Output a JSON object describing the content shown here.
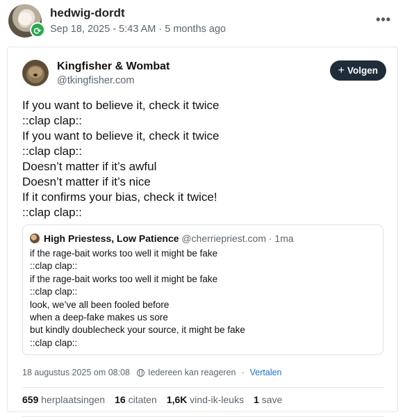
{
  "repost": {
    "user": "hedwig-dordt",
    "meta": "Sep 18, 2025 - 5:43 AM · 5 months ago",
    "more_label": "•••"
  },
  "post": {
    "author_name": "Kingfisher & Wombat",
    "author_handle": "@tkingfisher.com",
    "follow_label": "Volgen",
    "follow_icon": "plus-icon",
    "lines": [
      "If you want to believe it, check it twice",
      "::clap clap::",
      "If you want to believe it, check it twice",
      "::clap clap::",
      "Doesn’t matter if it’s awful",
      "Doesn’t matter if it’s nice",
      "If it confirms your bias, check it twice!",
      "::clap clap::"
    ],
    "quote": {
      "name": "High Priestess, Low Patience",
      "handle": "@cherriepriest.com",
      "time": "· 1ma",
      "lines": [
        "if the rage-bait works too well it might be fake",
        "::clap clap::",
        "if the rage-bait works too well it might be fake",
        "::clap clap::",
        "look, we’ve all been fooled before",
        "when a deep-fake makes us sore",
        "but kindly doublecheck your source, it might be fake",
        "::clap clap::"
      ]
    },
    "date": "18 augustus 2025 om 08:08",
    "reply_setting": "Iedereen kan reageren",
    "translate_label": "Vertalen",
    "stats": {
      "reposts_count": "659",
      "reposts_label": "herplaatsingen",
      "quotes_count": "16",
      "quotes_label": "citaten",
      "likes_count": "1,6K",
      "likes_label": "vind-ik-leuks",
      "saves_count": "1",
      "saves_label": "save"
    }
  }
}
